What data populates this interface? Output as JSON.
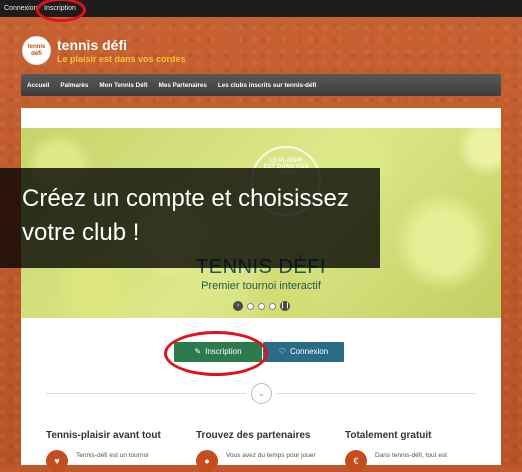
{
  "topbar": {
    "login": "Connexion",
    "signup": "Inscription"
  },
  "logo": {
    "ball_text": "tennis défi",
    "title": "tennis défi",
    "tagline": "Le plaisir est dans vos cordes"
  },
  "nav": {
    "items": [
      "Accueil",
      "Palmarès",
      "Mon Tennis Défi",
      "Mes Partenaires",
      "Les clubs inscrits sur tennis-défi"
    ]
  },
  "hero": {
    "seal_text": "LE PLAISIR EST DANS VOS CORDES",
    "title": "TENNIS DÉFI",
    "subtitle": "Premier tournoi interactif",
    "dots_count": 3
  },
  "overlay": {
    "text": "Créez un compte et choisissez votre club !"
  },
  "buttons": {
    "signup": "Inscription",
    "login": "Connexion"
  },
  "features": [
    {
      "title": "Tennis-plaisir avant tout",
      "text": "Tennis-défi est un tournoi",
      "icon": "heart-icon"
    },
    {
      "title": "Trouvez des partenaires",
      "text": "Vous avez du temps pour jouer",
      "icon": "user-icon"
    },
    {
      "title": "Totalement gratuit",
      "text": "Dans tennis-défi, tout est",
      "icon": "euro-icon"
    }
  ],
  "colors": {
    "annotation": "#e0121b",
    "signup_button": "#2e7a4f",
    "login_button": "#2a6b88",
    "tagline": "#f6c23a"
  }
}
